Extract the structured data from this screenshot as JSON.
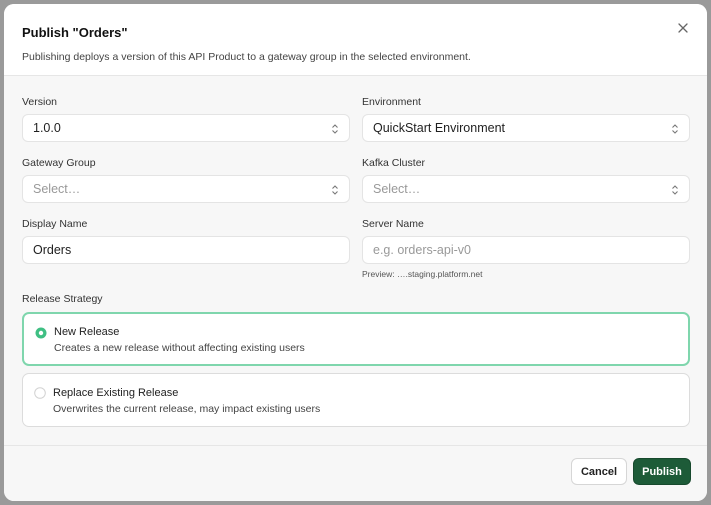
{
  "dialog": {
    "title": "Publish \"Orders\"",
    "subtitle": "Publishing deploys a version of this API Product to a gateway group in the selected environment."
  },
  "form": {
    "version": {
      "label": "Version",
      "value": "1.0.0"
    },
    "environment": {
      "label": "Environment",
      "value": "QuickStart Environment"
    },
    "gateway_group": {
      "label": "Gateway Group",
      "placeholder": "Select…"
    },
    "kafka_cluster": {
      "label": "Kafka Cluster",
      "placeholder": "Select…"
    },
    "display_name": {
      "label": "Display Name",
      "value": "Orders"
    },
    "server_name": {
      "label": "Server Name",
      "placeholder": "e.g. orders-api-v0",
      "preview": "Preview: ….staging.platform.net"
    }
  },
  "release_strategy": {
    "label": "Release Strategy",
    "options": [
      {
        "title": "New Release",
        "description": "Creates a new release without affecting existing users",
        "selected": true
      },
      {
        "title": "Replace Existing Release",
        "description": "Overwrites the current release, may impact existing users",
        "selected": false
      }
    ]
  },
  "footer": {
    "cancel_label": "Cancel",
    "publish_label": "Publish"
  },
  "colors": {
    "accent": "#1d5b38",
    "selected_border": "#7fd6ad",
    "radio_selected": "#3fbf83"
  },
  "icons": {
    "close": "close-icon",
    "select": "chevron-up-down-icon",
    "radio_on": "radio-selected-icon",
    "radio_off": "radio-unselected-icon"
  }
}
